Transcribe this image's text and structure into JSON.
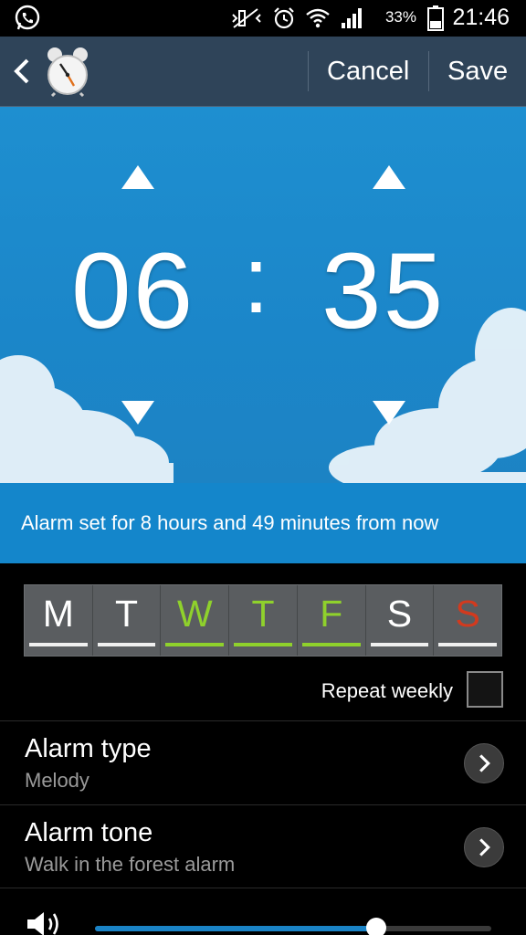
{
  "status_bar": {
    "battery_percent": "33%",
    "time": "21:46",
    "icons": [
      "whatsapp-icon",
      "mute-icon",
      "alarm-icon",
      "wifi-icon",
      "signal-icon",
      "battery-icon"
    ]
  },
  "action_bar": {
    "back_icon": "chevron-left-icon",
    "app_icon": "alarm-clock-icon",
    "cancel_label": "Cancel",
    "save_label": "Save"
  },
  "time_picker": {
    "hour": "06",
    "separator": ":",
    "minute": "35"
  },
  "info": {
    "message": "Alarm set for 8 hours and 49 minutes from now"
  },
  "days": [
    {
      "letter": "M",
      "selected": false
    },
    {
      "letter": "T",
      "selected": false
    },
    {
      "letter": "W",
      "selected": true
    },
    {
      "letter": "T",
      "selected": true
    },
    {
      "letter": "F",
      "selected": true
    },
    {
      "letter": "S",
      "selected": false
    },
    {
      "letter": "S",
      "selected": false,
      "sunday": true
    }
  ],
  "repeat": {
    "label": "Repeat weekly",
    "checked": false
  },
  "alarm_type": {
    "title": "Alarm type",
    "value": "Melody"
  },
  "alarm_tone": {
    "title": "Alarm tone",
    "value": "Walk in the forest alarm"
  },
  "volume": {
    "icon": "speaker-icon",
    "level": 0.71
  },
  "colors": {
    "selected_day": "#8fd12c",
    "sunday": "#d23a1e",
    "unselected_text": "#ffffff",
    "sky": "#1e8fd0",
    "info_bar": "#1486cb",
    "action_bar": "#2f4459"
  }
}
